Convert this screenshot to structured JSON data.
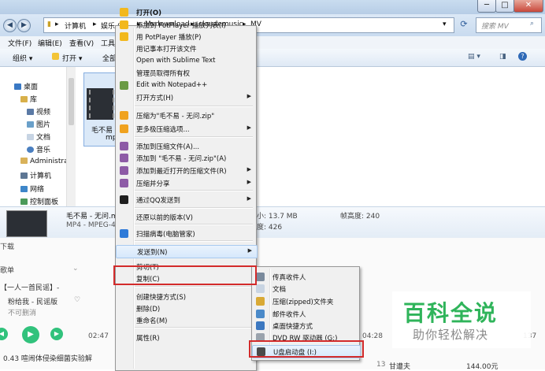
{
  "window": {
    "minimize": "─",
    "maximize": "□",
    "close": "✕"
  },
  "address": {
    "crumbs": [
      "计算机",
      "娱乐 (F:)",
      "Mydownload",
      "cloudemusic",
      "MV"
    ],
    "search_placeholder": "搜索 MV"
  },
  "menubar": [
    "文件(F)",
    "编辑(E)",
    "查看(V)",
    "工具"
  ],
  "toolbar": {
    "organize": "组织 ▾",
    "open": "打开 ▾",
    "all": "全部"
  },
  "nav": {
    "items": [
      "桌面",
      "库",
      "视频",
      "图片",
      "文档",
      "音乐",
      "Administra",
      "计算机",
      "网络",
      "控制面板"
    ]
  },
  "file": {
    "name": "毛不易 - 无问.mp4",
    "name_short": "毛不易 -",
    "name_ext": "mp"
  },
  "details": {
    "title": "毛不易 - 无问.m",
    "type": "MP4 - MPEG-4",
    "size": "小: 13.7 MB",
    "frame_width": "帧高度: 240",
    "length": "度: 426"
  },
  "context_menu": {
    "items": [
      {
        "label": "打开(O)",
        "bold": true,
        "icon": "potplayer-icon"
      },
      {
        "label": "添加到 PotPlayer 播放列表(I)",
        "icon": "potplayer-icon"
      },
      {
        "label": "用 PotPlayer 播放(P)",
        "icon": "potplayer-icon"
      },
      {
        "label": "用记事本打开该文件"
      },
      {
        "label": "Open with Sublime Text"
      },
      {
        "label": "管理员取得所有权"
      },
      {
        "label": "Edit with Notepad++",
        "icon": "notepad-icon"
      },
      {
        "label": "打开方式(H)",
        "submenu": true
      },
      {
        "label": "压缩为\"毛不易 - 无问.zip\"",
        "icon": "archive-icon"
      },
      {
        "label": "更多极压缩选项...",
        "icon": "archive-icon",
        "submenu": true
      },
      {
        "label": "添加到压缩文件(A)...",
        "icon": "winrar-icon"
      },
      {
        "label": "添加到 \"毛不易 - 无问.zip\"(A)",
        "icon": "winrar-icon"
      },
      {
        "label": "添加到最近打开的压缩文件(R)",
        "icon": "winrar-icon",
        "submenu": true
      },
      {
        "label": "压缩并分享",
        "icon": "winrar-icon",
        "submenu": true
      },
      {
        "label": "通过QQ发送到",
        "icon": "qq-icon",
        "submenu": true
      },
      {
        "label": "还原以前的版本(V)"
      },
      {
        "label": "扫描病毒(电脑管家)",
        "icon": "shield-icon"
      },
      {
        "label": "发送到(N)",
        "submenu": true
      },
      {
        "label": "剪切(T)"
      },
      {
        "label": "复制(C)"
      },
      {
        "label": "创建快捷方式(S)"
      },
      {
        "label": "删除(D)"
      },
      {
        "label": "重命名(M)"
      },
      {
        "label": "属性(R)"
      }
    ]
  },
  "send_to": {
    "items": [
      {
        "label": "传真收件人",
        "icon": "fax-icon"
      },
      {
        "label": "文档",
        "icon": "documents-icon"
      },
      {
        "label": "压缩(zipped)文件夹",
        "icon": "zip-folder-icon"
      },
      {
        "label": "邮件收件人",
        "icon": "mail-icon"
      },
      {
        "label": "桌面快捷方式",
        "icon": "desktop-icon"
      },
      {
        "label": "DVD RW 驱动器 (G:)",
        "icon": "dvd-icon"
      },
      {
        "label": "U盘启动盘 (I:)",
        "icon": "usb-drive-icon"
      }
    ]
  },
  "music": {
    "left_labels": [
      "下载",
      "歌单",
      "【一人一首民谣】-",
      "粉给我 - 民谣版",
      "不可删消"
    ],
    "time_current": "02:47",
    "time_right": "04:28",
    "right_num": "137",
    "bottom_title": "0.43   喧闹体侵染细菌实验解",
    "row_num": "13",
    "row_title": "甘遭夫",
    "row_price": "144.00元"
  },
  "watermark": {
    "title": "百科全说",
    "subtitle": "助你轻松解决"
  }
}
